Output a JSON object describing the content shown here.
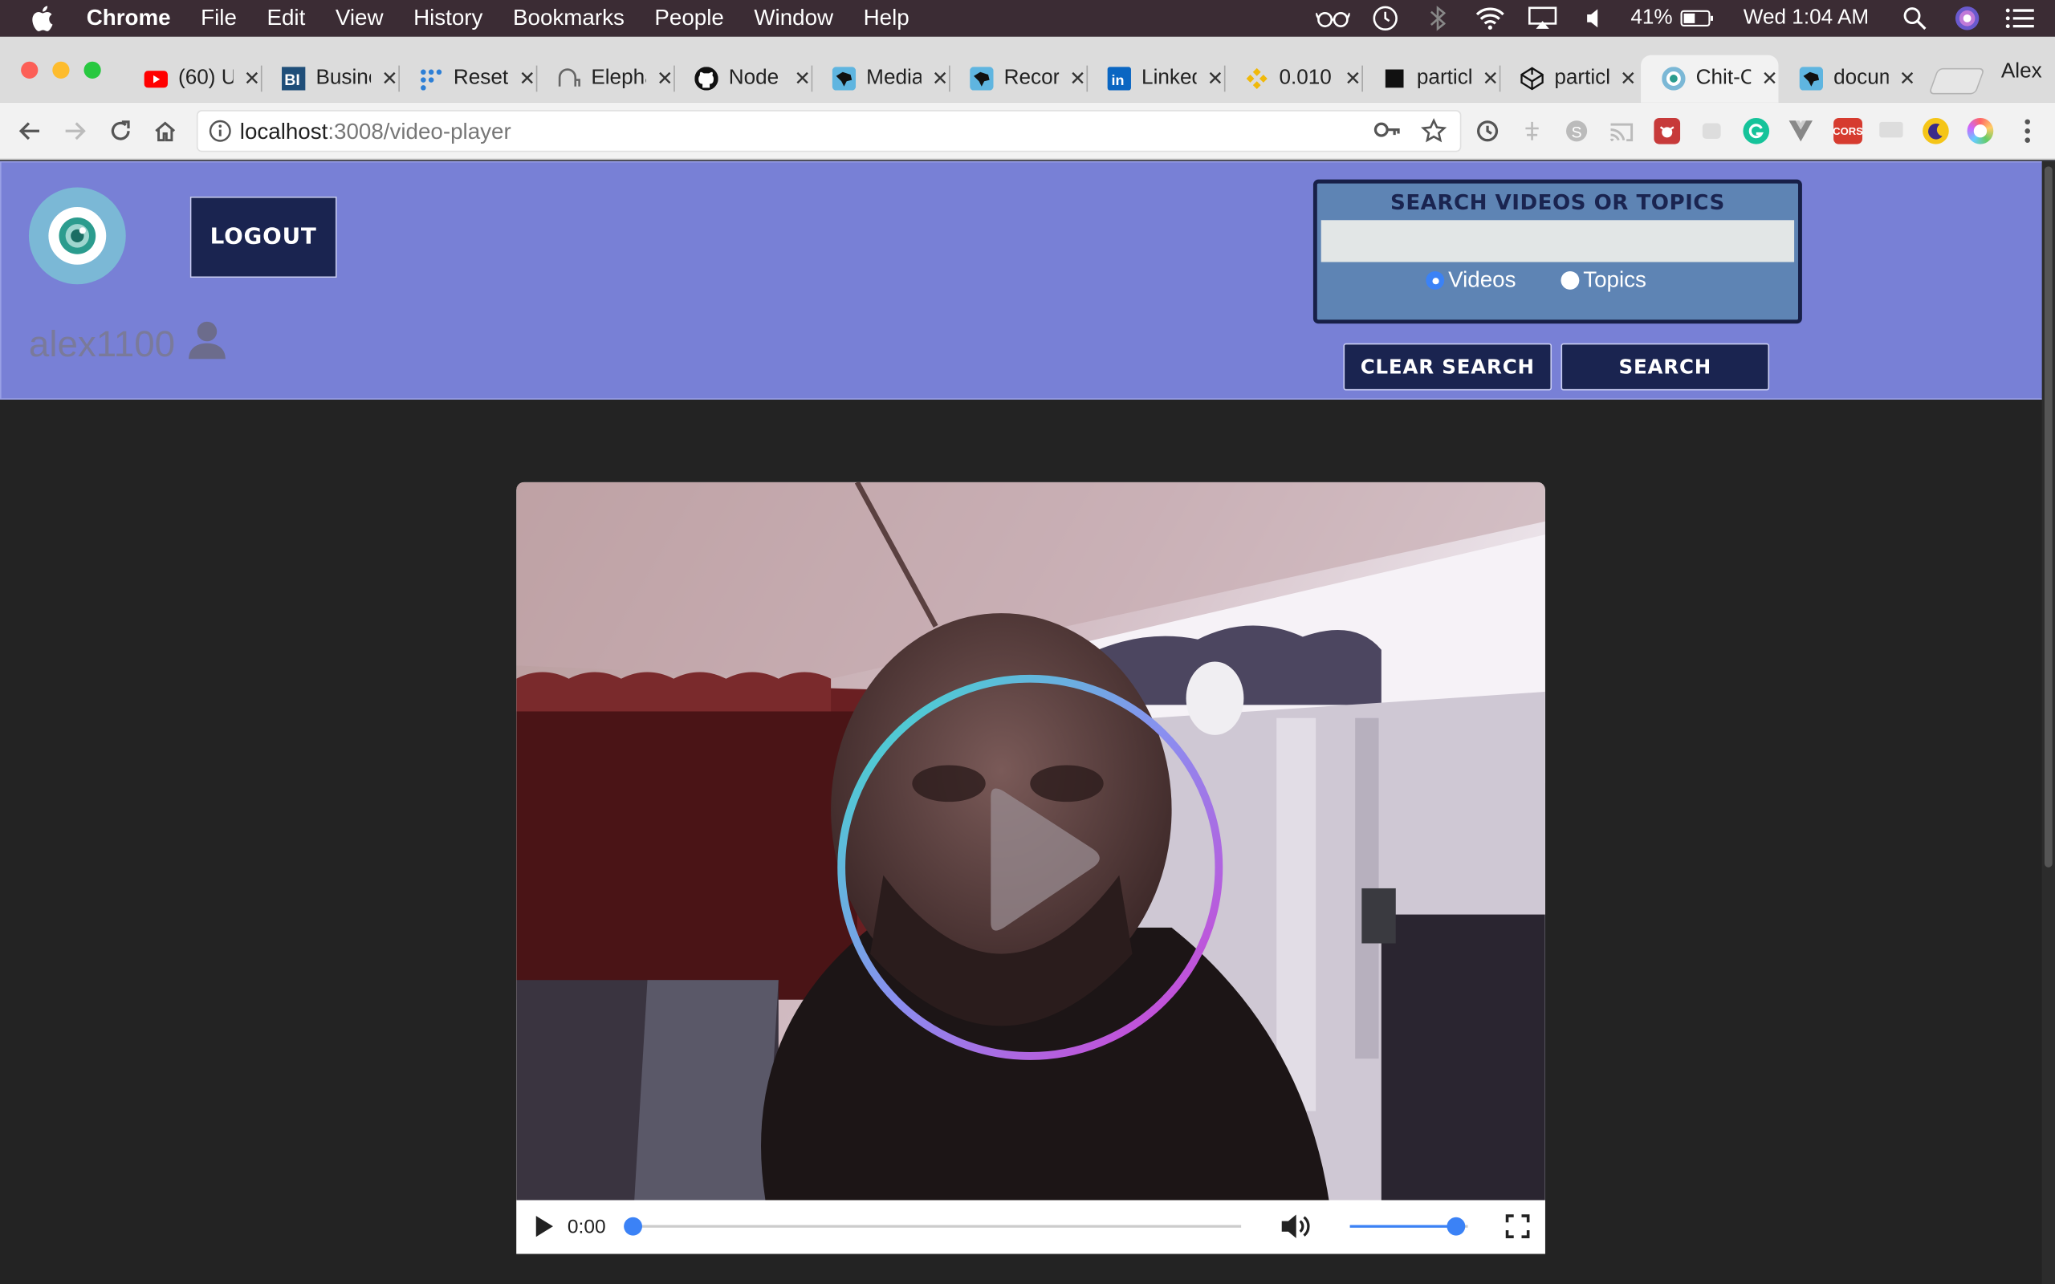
{
  "menubar": {
    "app": "Chrome",
    "items": [
      "File",
      "Edit",
      "View",
      "History",
      "Bookmarks",
      "People",
      "Window",
      "Help"
    ],
    "battery": "41%",
    "clock": "Wed 1:04 AM"
  },
  "tabs": [
    {
      "label": "(60) U",
      "icon": "youtube-icon"
    },
    {
      "label": "Business",
      "icon": "bi-icon"
    },
    {
      "label": "Reset",
      "icon": "dots-icon"
    },
    {
      "label": "Elephant",
      "icon": "elephant-icon"
    },
    {
      "label": "Node",
      "icon": "github-icon"
    },
    {
      "label": "Media",
      "icon": "panther-icon"
    },
    {
      "label": "Record",
      "icon": "panther-icon"
    },
    {
      "label": "LinkedIn",
      "icon": "linkedin-icon"
    },
    {
      "label": "0.010",
      "icon": "binance-icon"
    },
    {
      "label": "particle",
      "icon": "square-icon"
    },
    {
      "label": "particle",
      "icon": "codepen-icon"
    },
    {
      "label": "Chit-Chat",
      "icon": "eye-icon",
      "active": true
    },
    {
      "label": "docum",
      "icon": "panther-icon"
    }
  ],
  "profile_name": "Alex",
  "toolbar": {
    "url_host": "localhost",
    "url_rest": ":3008/video-player"
  },
  "header": {
    "logout_label": "LOGOUT",
    "username": "alex1100",
    "search_title": "SEARCH VIDEOS OR TOPICS",
    "search_value": "",
    "radio_videos": "Videos",
    "radio_topics": "Topics",
    "selected_radio": "Videos",
    "clear_label": "CLEAR SEARCH",
    "search_label": "SEARCH"
  },
  "video": {
    "current_time": "0:00",
    "progress": 0,
    "volume": 0.9
  },
  "colors": {
    "header_bg": "#7880d6",
    "button_bg": "#1a2450",
    "page_bg": "#232323"
  }
}
